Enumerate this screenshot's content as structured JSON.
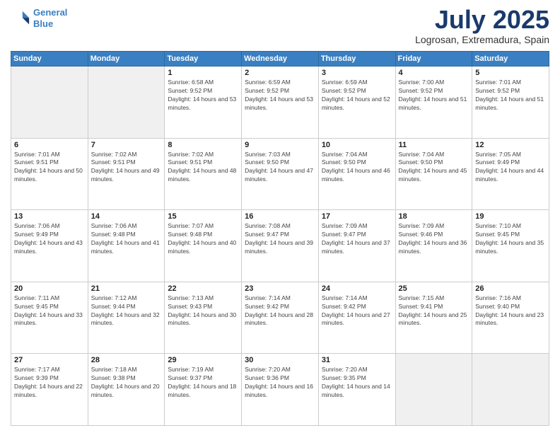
{
  "header": {
    "logo_line1": "General",
    "logo_line2": "Blue",
    "month": "July 2025",
    "location": "Logrosan, Extremadura, Spain"
  },
  "days_of_week": [
    "Sunday",
    "Monday",
    "Tuesday",
    "Wednesday",
    "Thursday",
    "Friday",
    "Saturday"
  ],
  "weeks": [
    [
      {
        "day": "",
        "info": ""
      },
      {
        "day": "",
        "info": ""
      },
      {
        "day": "1",
        "info": "Sunrise: 6:58 AM\nSunset: 9:52 PM\nDaylight: 14 hours and 53 minutes."
      },
      {
        "day": "2",
        "info": "Sunrise: 6:59 AM\nSunset: 9:52 PM\nDaylight: 14 hours and 53 minutes."
      },
      {
        "day": "3",
        "info": "Sunrise: 6:59 AM\nSunset: 9:52 PM\nDaylight: 14 hours and 52 minutes."
      },
      {
        "day": "4",
        "info": "Sunrise: 7:00 AM\nSunset: 9:52 PM\nDaylight: 14 hours and 51 minutes."
      },
      {
        "day": "5",
        "info": "Sunrise: 7:01 AM\nSunset: 9:52 PM\nDaylight: 14 hours and 51 minutes."
      }
    ],
    [
      {
        "day": "6",
        "info": "Sunrise: 7:01 AM\nSunset: 9:51 PM\nDaylight: 14 hours and 50 minutes."
      },
      {
        "day": "7",
        "info": "Sunrise: 7:02 AM\nSunset: 9:51 PM\nDaylight: 14 hours and 49 minutes."
      },
      {
        "day": "8",
        "info": "Sunrise: 7:02 AM\nSunset: 9:51 PM\nDaylight: 14 hours and 48 minutes."
      },
      {
        "day": "9",
        "info": "Sunrise: 7:03 AM\nSunset: 9:50 PM\nDaylight: 14 hours and 47 minutes."
      },
      {
        "day": "10",
        "info": "Sunrise: 7:04 AM\nSunset: 9:50 PM\nDaylight: 14 hours and 46 minutes."
      },
      {
        "day": "11",
        "info": "Sunrise: 7:04 AM\nSunset: 9:50 PM\nDaylight: 14 hours and 45 minutes."
      },
      {
        "day": "12",
        "info": "Sunrise: 7:05 AM\nSunset: 9:49 PM\nDaylight: 14 hours and 44 minutes."
      }
    ],
    [
      {
        "day": "13",
        "info": "Sunrise: 7:06 AM\nSunset: 9:49 PM\nDaylight: 14 hours and 43 minutes."
      },
      {
        "day": "14",
        "info": "Sunrise: 7:06 AM\nSunset: 9:48 PM\nDaylight: 14 hours and 41 minutes."
      },
      {
        "day": "15",
        "info": "Sunrise: 7:07 AM\nSunset: 9:48 PM\nDaylight: 14 hours and 40 minutes."
      },
      {
        "day": "16",
        "info": "Sunrise: 7:08 AM\nSunset: 9:47 PM\nDaylight: 14 hours and 39 minutes."
      },
      {
        "day": "17",
        "info": "Sunrise: 7:09 AM\nSunset: 9:47 PM\nDaylight: 14 hours and 37 minutes."
      },
      {
        "day": "18",
        "info": "Sunrise: 7:09 AM\nSunset: 9:46 PM\nDaylight: 14 hours and 36 minutes."
      },
      {
        "day": "19",
        "info": "Sunrise: 7:10 AM\nSunset: 9:45 PM\nDaylight: 14 hours and 35 minutes."
      }
    ],
    [
      {
        "day": "20",
        "info": "Sunrise: 7:11 AM\nSunset: 9:45 PM\nDaylight: 14 hours and 33 minutes."
      },
      {
        "day": "21",
        "info": "Sunrise: 7:12 AM\nSunset: 9:44 PM\nDaylight: 14 hours and 32 minutes."
      },
      {
        "day": "22",
        "info": "Sunrise: 7:13 AM\nSunset: 9:43 PM\nDaylight: 14 hours and 30 minutes."
      },
      {
        "day": "23",
        "info": "Sunrise: 7:14 AM\nSunset: 9:42 PM\nDaylight: 14 hours and 28 minutes."
      },
      {
        "day": "24",
        "info": "Sunrise: 7:14 AM\nSunset: 9:42 PM\nDaylight: 14 hours and 27 minutes."
      },
      {
        "day": "25",
        "info": "Sunrise: 7:15 AM\nSunset: 9:41 PM\nDaylight: 14 hours and 25 minutes."
      },
      {
        "day": "26",
        "info": "Sunrise: 7:16 AM\nSunset: 9:40 PM\nDaylight: 14 hours and 23 minutes."
      }
    ],
    [
      {
        "day": "27",
        "info": "Sunrise: 7:17 AM\nSunset: 9:39 PM\nDaylight: 14 hours and 22 minutes."
      },
      {
        "day": "28",
        "info": "Sunrise: 7:18 AM\nSunset: 9:38 PM\nDaylight: 14 hours and 20 minutes."
      },
      {
        "day": "29",
        "info": "Sunrise: 7:19 AM\nSunset: 9:37 PM\nDaylight: 14 hours and 18 minutes."
      },
      {
        "day": "30",
        "info": "Sunrise: 7:20 AM\nSunset: 9:36 PM\nDaylight: 14 hours and 16 minutes."
      },
      {
        "day": "31",
        "info": "Sunrise: 7:20 AM\nSunset: 9:35 PM\nDaylight: 14 hours and 14 minutes."
      },
      {
        "day": "",
        "info": ""
      },
      {
        "day": "",
        "info": ""
      }
    ]
  ]
}
